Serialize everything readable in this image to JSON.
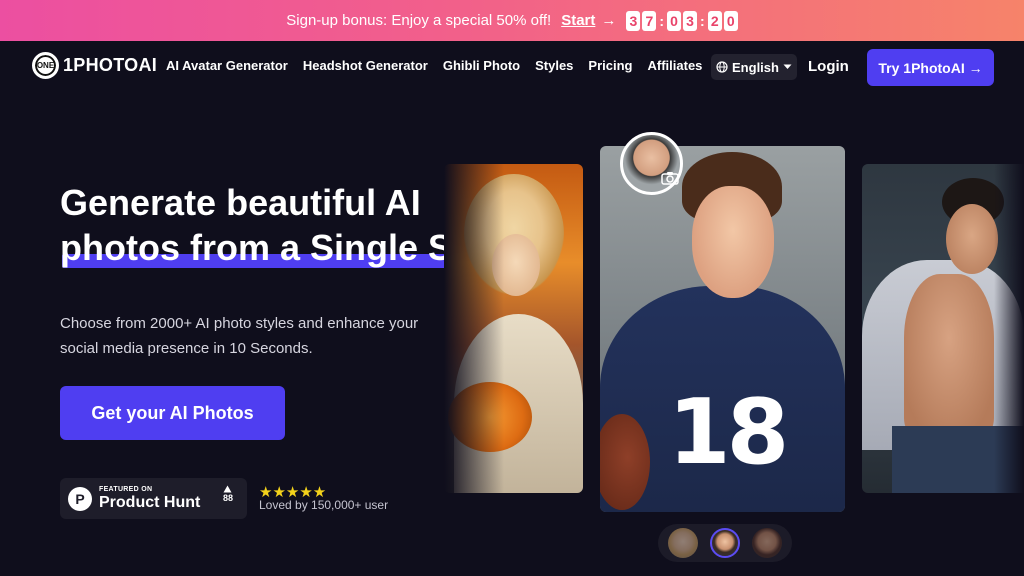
{
  "promo": {
    "text": "Sign-up bonus: Enjoy a special 50% off!",
    "start_label": "Start",
    "arrow": "→",
    "timer": [
      "3",
      "7",
      "0",
      "3",
      "2",
      "0"
    ]
  },
  "nav": {
    "logo_badge": "ONE",
    "logo_text": "1PHOTOAI",
    "links": [
      "AI Avatar Generator",
      "Headshot Generator",
      "Ghibli Photo",
      "Styles",
      "Pricing",
      "Affiliates"
    ],
    "language": "English",
    "login": "Login",
    "try_button": "Try 1PhotoAI →"
  },
  "hero": {
    "headline_line1": "Generate beautiful AI",
    "headline_line2": "photos from a Single Selfie",
    "subtext": "Choose from 2000+ AI photo styles and enhance your social media presence in 10 Seconds.",
    "cta": "Get your AI Photos"
  },
  "product_hunt": {
    "logo": "P",
    "featured": "FEATURED ON",
    "name": "Product Hunt",
    "votes": "88"
  },
  "rating": {
    "stars": "★★★★★",
    "loved": "Loved by 150,000+ user"
  },
  "images": {
    "main_jersey_number": "18"
  },
  "colors": {
    "accent": "#4f3ef1",
    "background": "#0f0e1c",
    "star": "#f3d21b"
  }
}
